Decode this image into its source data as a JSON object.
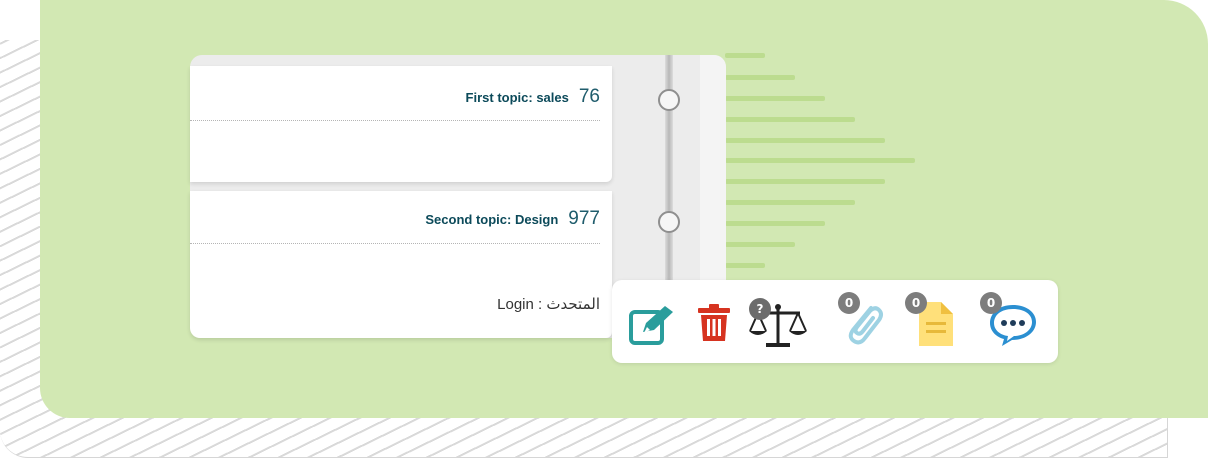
{
  "topics": [
    {
      "title": "First topic: sales",
      "number": "76"
    },
    {
      "title": "Second topic: Design",
      "number": "977"
    }
  ],
  "speaker": {
    "label": "المتحدث",
    "separator": ":",
    "value": "Login"
  },
  "toolbar": {
    "icons": [
      "edit-icon",
      "trash-icon",
      "scale-icon",
      "paperclip-icon",
      "document-icon",
      "chat-icon"
    ],
    "badges": {
      "scale": "?",
      "attachments": "0",
      "documents": "0",
      "comments": "0"
    }
  },
  "colors": {
    "background": "#d2e8b3",
    "accent": "#2a9d9c",
    "delete": "#d63320",
    "title": "#0c4a5a"
  }
}
